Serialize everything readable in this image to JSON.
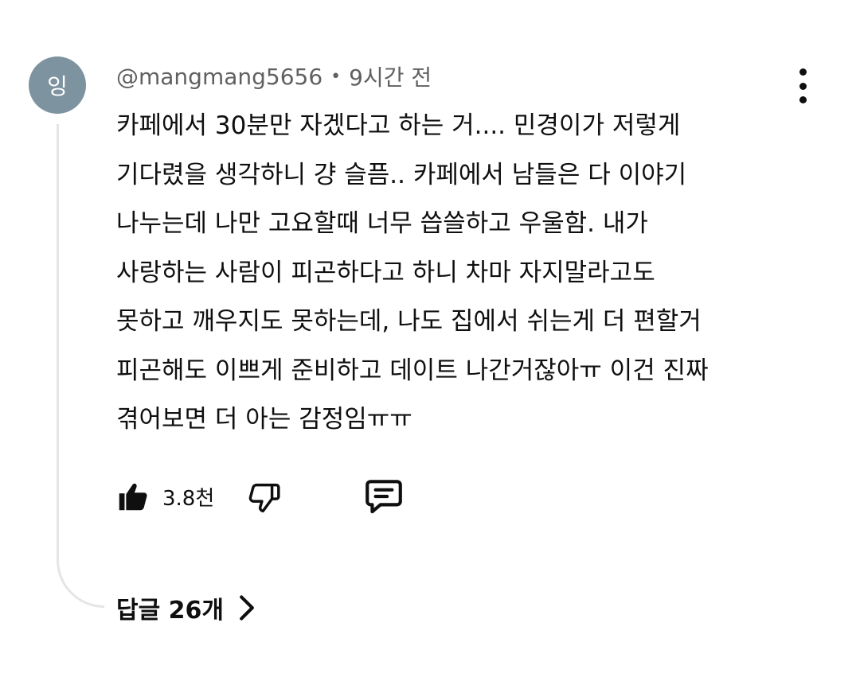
{
  "author": {
    "avatar_initial": "잉",
    "avatar_color": "#7d939f",
    "handle": "@mangmang5656",
    "separator": "•",
    "time_ago": "9시간 전"
  },
  "comment": {
    "lines": [
      "카페에서 30분만 자겠다고 하는 거.... 민경이가 저렇게",
      "기다렸을 생각하니 걍 슬픔.. 카페에서 남들은 다 이야기",
      "나누는데 나만 고요할때 너무 씁쓸하고 우울함. 내가",
      "사랑하는 사람이 피곤하다고 하니 차마 자지말라고도",
      "못하고 깨우지도 못하는데, 나도 집에서 쉬는게 더 편할거",
      "피곤해도 이쁘게 준비하고 데이트 나간거잖아ㅠ 이건 진짜",
      "겪어보면 더 아는 감정임ㅠㅠ"
    ]
  },
  "actions": {
    "like_icon": "thumbs-up-filled-icon",
    "like_count": "3.8천",
    "dislike_icon": "thumbs-down-icon",
    "reply_icon": "comment-icon",
    "more_icon": "more-vertical-icon"
  },
  "replies": {
    "label": "답글 26개",
    "chevron_icon": "chevron-right-icon"
  }
}
